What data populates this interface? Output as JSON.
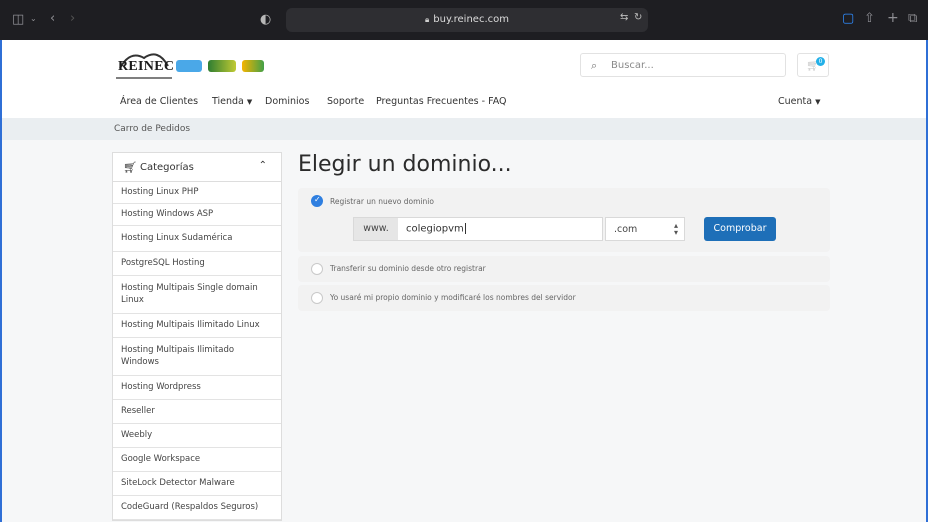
{
  "browser": {
    "url": "buy.reinec.com"
  },
  "header": {
    "logo_text": "REINEC",
    "search_placeholder": "Buscar...",
    "cart_count": "0",
    "nav": [
      {
        "label": "Área de Clientes"
      },
      {
        "label": "Tienda"
      },
      {
        "label": "Dominios"
      },
      {
        "label": "Soporte"
      },
      {
        "label": "Preguntas Frecuentes - FAQ"
      }
    ],
    "account_label": "Cuenta"
  },
  "breadcrumb": "Carro de Pedidos",
  "sidebar": {
    "title": "Categorías",
    "items": [
      "Hosting Linux PHP",
      "Hosting Windows ASP",
      "Hosting Linux Sudamérica",
      "PostgreSQL Hosting",
      "Hosting Multipais Single domain Linux",
      "Hosting Multipais Ilimitado Linux",
      "Hosting Multipais Ilimitado Windows",
      "Hosting Wordpress",
      "Reseller",
      "Weebly",
      "Google Workspace",
      "SiteLock Detector Malware",
      "CodeGuard (Respaldos Seguros)"
    ]
  },
  "main": {
    "title": "Elegir un dominio...",
    "options": [
      {
        "label": "Registrar un nuevo dominio",
        "selected": true
      },
      {
        "label": "Transferir su dominio desde otro registrar",
        "selected": false
      },
      {
        "label": "Yo usaré mi propio dominio y modificaré los nombres del servidor",
        "selected": false
      }
    ],
    "www_prefix": "www.",
    "domain_value": "colegiopvm",
    "tld_value": ".com",
    "check_button": "Comprobar"
  },
  "colors": {
    "primary_button": "#1e6fb8",
    "radio_checked": "#2f7fe0",
    "cart_badge": "#23b0e8"
  },
  "icons": [
    "sidebar-toggle-icon",
    "back-icon",
    "forward-icon",
    "shield-icon",
    "lock-icon",
    "translate-icon",
    "reload-icon",
    "share-icon",
    "new-tab-icon",
    "tabs-icon",
    "search-icon",
    "cart-icon",
    "check-icon"
  ]
}
